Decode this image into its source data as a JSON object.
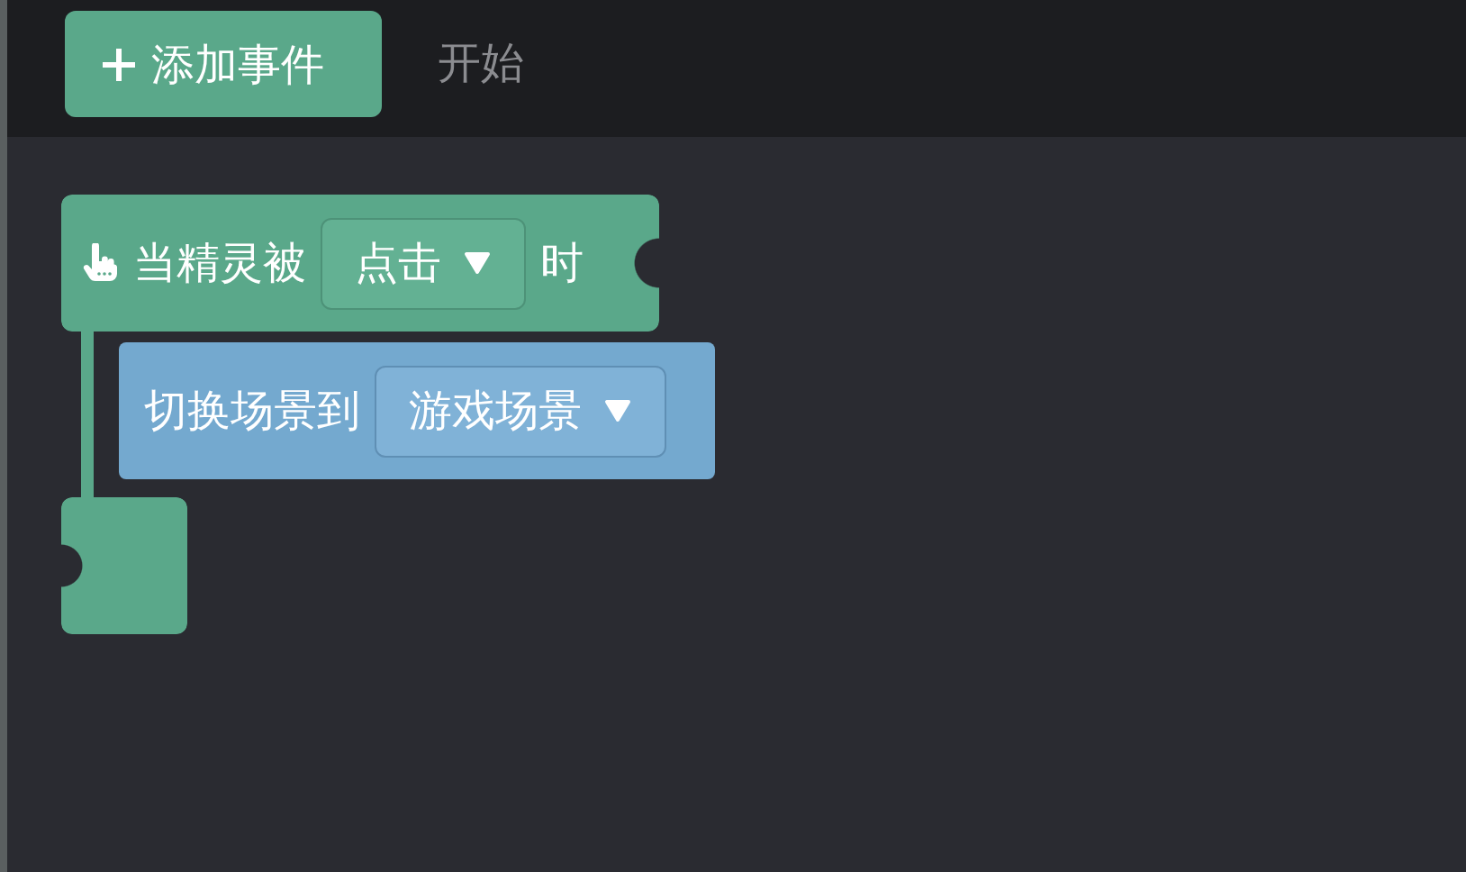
{
  "toolbar": {
    "add_button": "添加事件",
    "label": "开始"
  },
  "blocks": [
    {
      "kind": "event",
      "prefix": "当精灵被",
      "dropdown": "点击",
      "suffix": "时",
      "children": [
        {
          "kind": "action",
          "text": "切换场景到",
          "dropdown": "游戏场景"
        }
      ]
    }
  ]
}
